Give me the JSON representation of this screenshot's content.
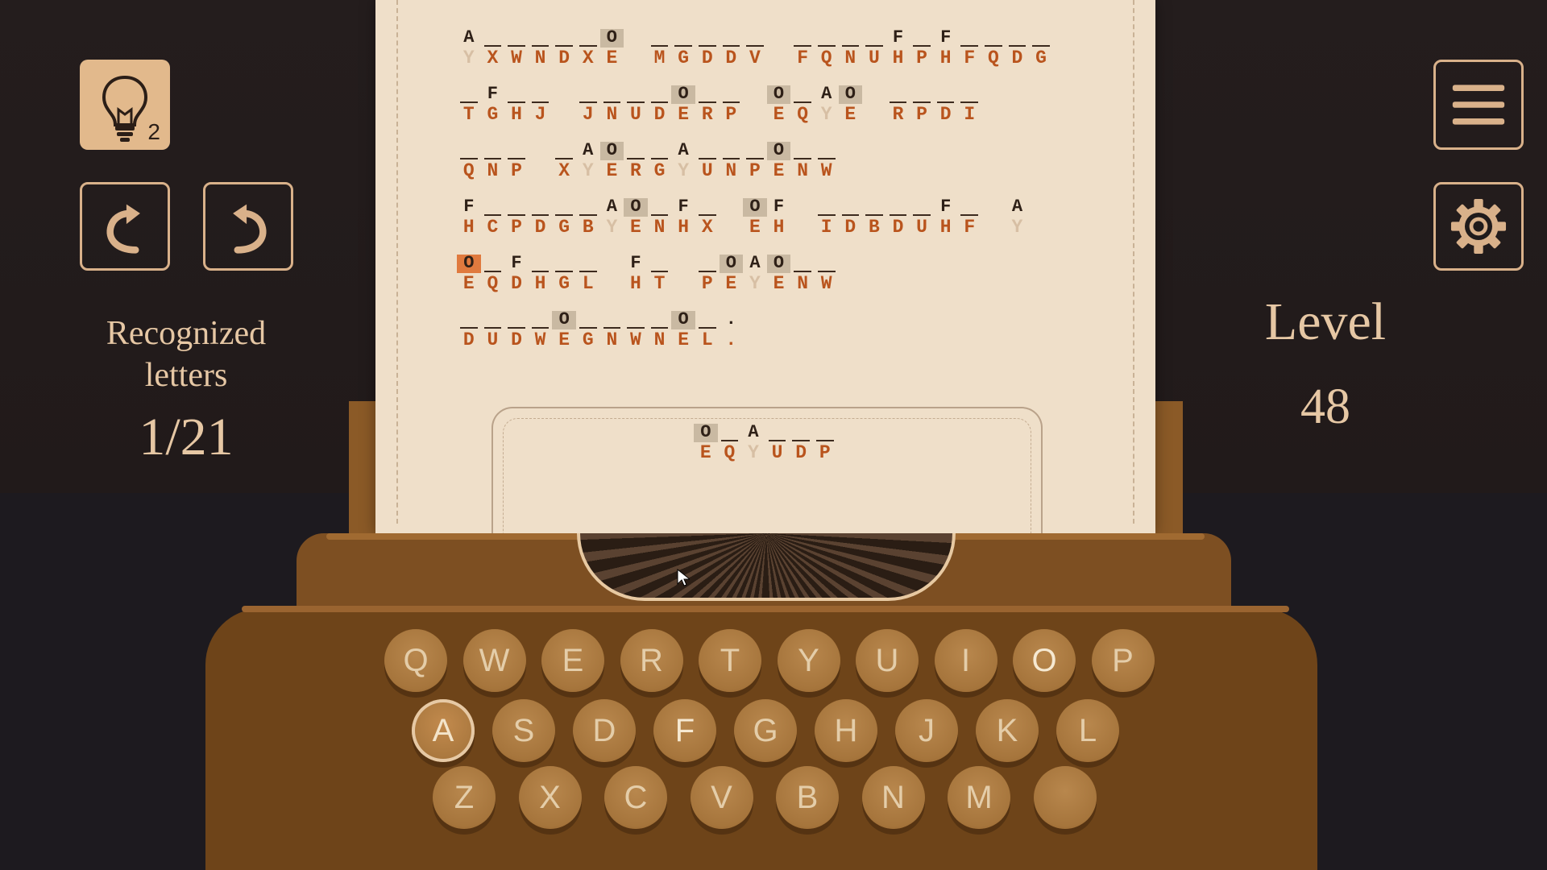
{
  "hud": {
    "hint_count": "2",
    "recognized_label": "Recognized letters",
    "recognized_value": "1/21",
    "level_label": "Level",
    "level_value": "48"
  },
  "icons": {
    "hint": "lightbulb-icon",
    "undo": "undo-arrow-icon",
    "redo": "redo-arrow-icon",
    "menu": "hamburger-menu-icon",
    "settings": "gear-icon"
  },
  "colors": {
    "paper": "#efdfc9",
    "cipher_text": "#b9541d",
    "accent_active": "#e07a3e",
    "hud_text": "#e6c7a4"
  },
  "puzzle": {
    "rows": [
      [
        [
          "A",
          "Y"
        ],
        [
          "",
          "X"
        ],
        [
          "",
          "W"
        ],
        [
          "",
          "N"
        ],
        [
          "",
          "D"
        ],
        [
          "",
          "X"
        ],
        [
          "O",
          "E"
        ],
        [
          " ",
          " "
        ],
        [
          "",
          "M"
        ],
        [
          "",
          "G"
        ],
        [
          "",
          "D"
        ],
        [
          "",
          "D"
        ],
        [
          "",
          "V"
        ],
        [
          " ",
          " "
        ],
        [
          "",
          "F"
        ],
        [
          "",
          "Q"
        ],
        [
          "",
          "N"
        ],
        [
          "",
          "U"
        ],
        [
          "F",
          "H"
        ],
        [
          "",
          "P"
        ],
        [
          "F",
          "H"
        ],
        [
          "",
          "F"
        ],
        [
          "",
          "Q"
        ],
        [
          "",
          "D"
        ],
        [
          "",
          "G"
        ]
      ],
      [
        [
          "",
          "T"
        ],
        [
          "F",
          "G"
        ],
        [
          "",
          "H"
        ],
        [
          "",
          "J"
        ],
        [
          " ",
          " "
        ],
        [
          "",
          "J"
        ],
        [
          "",
          "N"
        ],
        [
          "",
          "U"
        ],
        [
          "",
          "D"
        ],
        [
          "O",
          "E"
        ],
        [
          "",
          "R"
        ],
        [
          "",
          "P"
        ],
        [
          " ",
          " "
        ],
        [
          "O",
          "E"
        ],
        [
          "",
          "Q"
        ],
        [
          "A",
          "Y"
        ],
        [
          "O",
          "E"
        ],
        [
          " ",
          " "
        ],
        [
          "",
          "R"
        ],
        [
          "",
          "P"
        ],
        [
          "",
          "D"
        ],
        [
          "",
          "I"
        ]
      ],
      [
        [
          "",
          "Q"
        ],
        [
          "",
          "N"
        ],
        [
          "",
          "P"
        ],
        [
          " ",
          " "
        ],
        [
          "",
          "X"
        ],
        [
          "A",
          "Y"
        ],
        [
          "O",
          "E"
        ],
        [
          "",
          "R"
        ],
        [
          "",
          "G"
        ],
        [
          "A",
          "Y"
        ],
        [
          "",
          "U"
        ],
        [
          "",
          "N"
        ],
        [
          "",
          "P"
        ],
        [
          "O",
          "E"
        ],
        [
          "",
          "N"
        ],
        [
          "",
          "W"
        ]
      ],
      [
        [
          "F",
          "H"
        ],
        [
          "",
          "C"
        ],
        [
          "",
          "P"
        ],
        [
          "",
          "D"
        ],
        [
          "",
          "G"
        ],
        [
          "",
          "B"
        ],
        [
          "A",
          "Y"
        ],
        [
          "O",
          "E"
        ],
        [
          "",
          "N"
        ],
        [
          "F",
          "H"
        ],
        [
          "",
          "X"
        ],
        [
          " ",
          " "
        ],
        [
          "O",
          "E"
        ],
        [
          "F",
          "H"
        ],
        [
          " ",
          " "
        ],
        [
          "",
          "I"
        ],
        [
          "",
          "D"
        ],
        [
          "",
          "B"
        ],
        [
          "",
          "D"
        ],
        [
          "",
          "U"
        ],
        [
          "F",
          "H"
        ],
        [
          "",
          "F"
        ],
        [
          " ",
          " "
        ],
        [
          "A",
          "Y"
        ]
      ],
      [
        [
          "O",
          "E"
        ],
        [
          "",
          "Q"
        ],
        [
          "F",
          "D"
        ],
        [
          "",
          "H"
        ],
        [
          "",
          "G"
        ],
        [
          "",
          "L"
        ],
        [
          " ",
          " "
        ],
        [
          "F",
          "H"
        ],
        [
          "",
          "T"
        ],
        [
          " ",
          " "
        ],
        [
          "",
          "P"
        ],
        [
          "O",
          "E"
        ],
        [
          "A",
          "Y"
        ],
        [
          "O",
          "E"
        ],
        [
          "",
          "N"
        ],
        [
          "",
          "W"
        ]
      ],
      [
        [
          "",
          "D"
        ],
        [
          "",
          "U"
        ],
        [
          "",
          "D"
        ],
        [
          "",
          "W"
        ],
        [
          "O",
          "E"
        ],
        [
          "",
          "G"
        ],
        [
          "",
          "N"
        ],
        [
          "",
          "W"
        ],
        [
          "",
          "N"
        ],
        [
          "O",
          "E"
        ],
        [
          "",
          "L"
        ],
        [
          ".",
          "."
        ]
      ]
    ],
    "current_word": [
      [
        "O",
        "E"
      ],
      [
        "",
        "Q"
      ],
      [
        "A",
        "Y"
      ],
      [
        "",
        "U"
      ],
      [
        "",
        "D"
      ],
      [
        "",
        "P"
      ]
    ]
  },
  "keyboard": {
    "row1": [
      "Q",
      "W",
      "E",
      "R",
      "T",
      "Y",
      "U",
      "I",
      "O",
      "P"
    ],
    "row2": [
      "A",
      "S",
      "D",
      "F",
      "G",
      "H",
      "J",
      "K",
      "L"
    ],
    "row3": [
      "Z",
      "X",
      "C",
      "V",
      "B",
      "N",
      "M",
      ""
    ],
    "pressed": "A",
    "used": [
      "O",
      "F"
    ]
  }
}
